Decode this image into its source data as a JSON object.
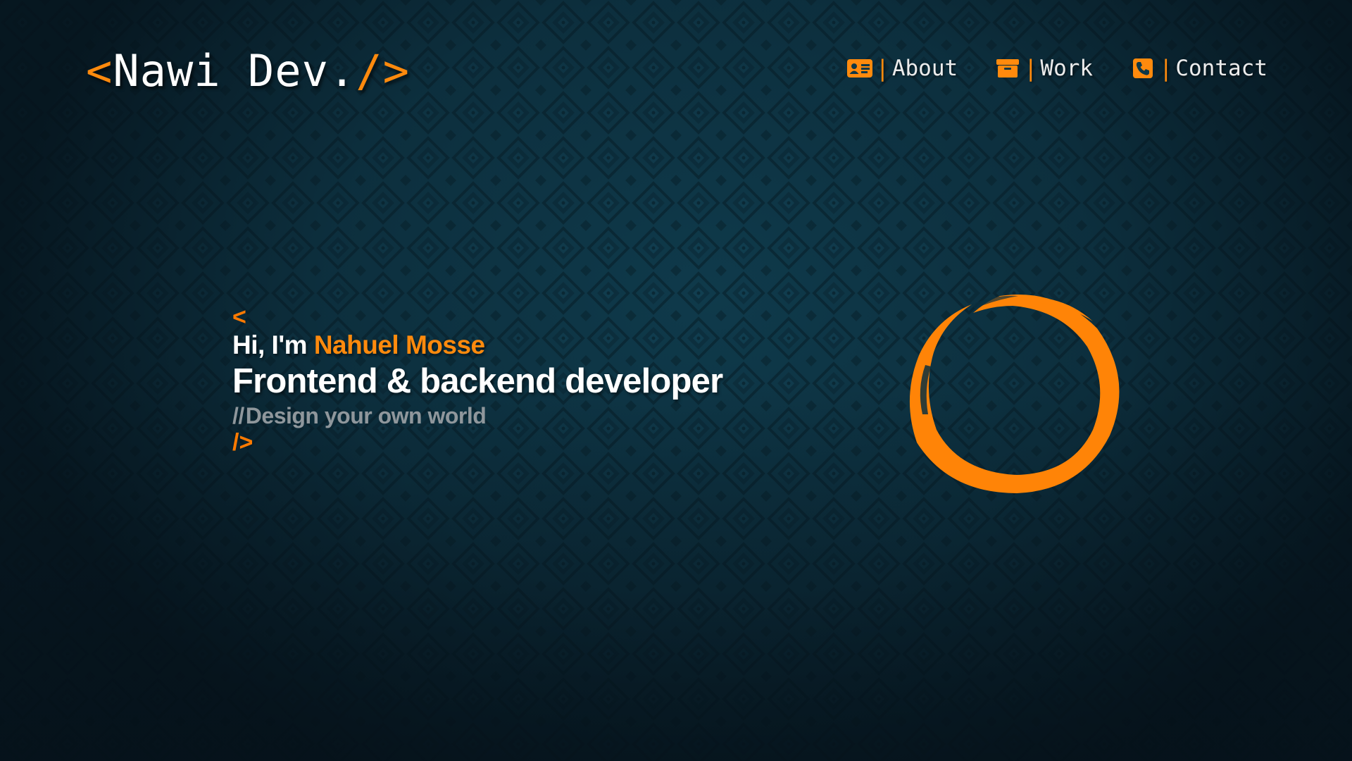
{
  "header": {
    "logo": {
      "open": "<",
      "name": "Nawi Dev.",
      "close": "/>"
    }
  },
  "nav": {
    "items": [
      {
        "label": "About",
        "icon": "id-card-icon",
        "separator": "|"
      },
      {
        "label": "Work",
        "icon": "archive-box-icon",
        "separator": "|"
      },
      {
        "label": "Contact",
        "icon": "phone-icon",
        "separator": "|"
      }
    ]
  },
  "hero": {
    "open_bracket": "<",
    "greeting_prefix": "Hi, I'm ",
    "greeting_name": "Nahuel Mosse",
    "headline": "Frontend & backend developer",
    "tagline_slashes": "//",
    "tagline": "Design your own world",
    "close_bracket": "/>"
  },
  "theme": {
    "accent": "#ff8a0d",
    "background": "#0f3848",
    "text": "#ffffff",
    "muted": "#8f979c"
  },
  "decor": {
    "enso": "enso-circle-icon"
  }
}
